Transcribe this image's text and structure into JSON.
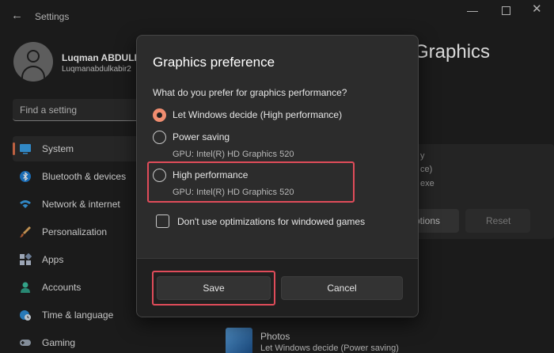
{
  "window": {
    "app_title": "Settings",
    "back_symbol": "←",
    "close_symbol": "✕"
  },
  "profile": {
    "name": "Luqman ABDULK",
    "email": "Luqmanabdulkabir2"
  },
  "search": {
    "placeholder": "Find a setting"
  },
  "sidebar": {
    "items": [
      {
        "label": "System",
        "icon": "monitor-icon",
        "active": true
      },
      {
        "label": "Bluetooth & devices",
        "icon": "bluetooth-icon"
      },
      {
        "label": "Network & internet",
        "icon": "wifi-icon"
      },
      {
        "label": "Personalization",
        "icon": "brush-icon"
      },
      {
        "label": "Apps",
        "icon": "apps-icon"
      },
      {
        "label": "Accounts",
        "icon": "person-icon"
      },
      {
        "label": "Time & language",
        "icon": "globe-clock-icon"
      },
      {
        "label": "Gaming",
        "icon": "gamepad-icon"
      }
    ]
  },
  "background": {
    "heading_fragment": "Graphics",
    "card_text": [
      "y",
      "ce)",
      "exe"
    ],
    "options_label": "ptions",
    "reset_label": "Reset",
    "photos": {
      "title": "Photos",
      "subtitle": "Let Windows decide (Power saving)"
    }
  },
  "dialog": {
    "title": "Graphics preference",
    "question": "What do you prefer for graphics performance?",
    "options": [
      {
        "label": "Let Windows decide (High performance)",
        "selected": true,
        "sub": ""
      },
      {
        "label": "Power saving",
        "selected": false,
        "sub": "GPU: Intel(R) HD Graphics 520"
      },
      {
        "label": "High performance",
        "selected": false,
        "sub": "GPU: Intel(R) HD Graphics 520"
      }
    ],
    "checkbox_label": "Don't use optimizations for windowed games",
    "checkbox_checked": false,
    "save_label": "Save",
    "cancel_label": "Cancel"
  },
  "colors": {
    "accent": "#f08d70",
    "highlight": "#e04c5a",
    "background": "#202020",
    "dialog": "#2c2c2c"
  }
}
